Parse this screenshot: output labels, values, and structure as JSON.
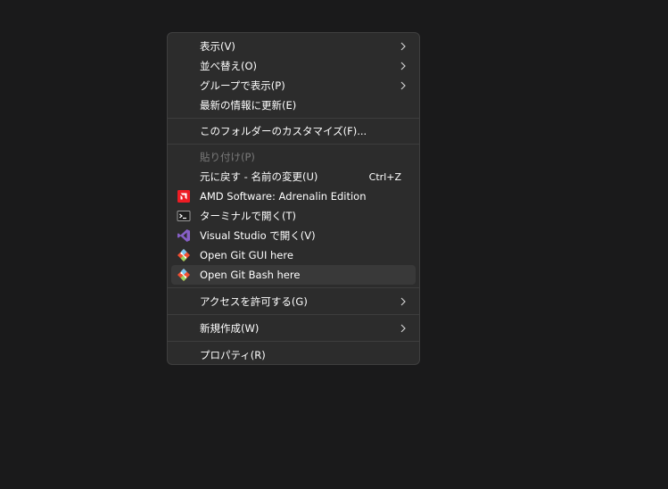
{
  "menu": {
    "items": [
      {
        "label": "表示(V)",
        "submenu": true
      },
      {
        "label": "並べ替え(O)",
        "submenu": true
      },
      {
        "label": "グループで表示(P)",
        "submenu": true
      },
      {
        "label": "最新の情報に更新(E)"
      },
      {
        "label": "このフォルダーのカスタマイズ(F)..."
      },
      {
        "label": "貼り付け(P)",
        "disabled": true
      },
      {
        "label": "元に戻す - 名前の変更(U)",
        "shortcut": "Ctrl+Z"
      },
      {
        "label": "AMD Software: Adrenalin Edition",
        "icon": "amd-icon"
      },
      {
        "label": "ターミナルで開く(T)",
        "icon": "terminal-icon"
      },
      {
        "label": "Visual Studio で開く(V)",
        "icon": "visual-studio-icon"
      },
      {
        "label": "Open Git GUI here",
        "icon": "git-icon"
      },
      {
        "label": "Open Git Bash here",
        "icon": "git-icon"
      },
      {
        "label": "アクセスを許可する(G)",
        "submenu": true
      },
      {
        "label": "新規作成(W)",
        "submenu": true
      },
      {
        "label": "プロパティ(R)"
      }
    ]
  },
  "colors": {
    "amd_red": "#ed1c24",
    "vs_purple": "#865fc5",
    "git_orange": "#f05033"
  }
}
